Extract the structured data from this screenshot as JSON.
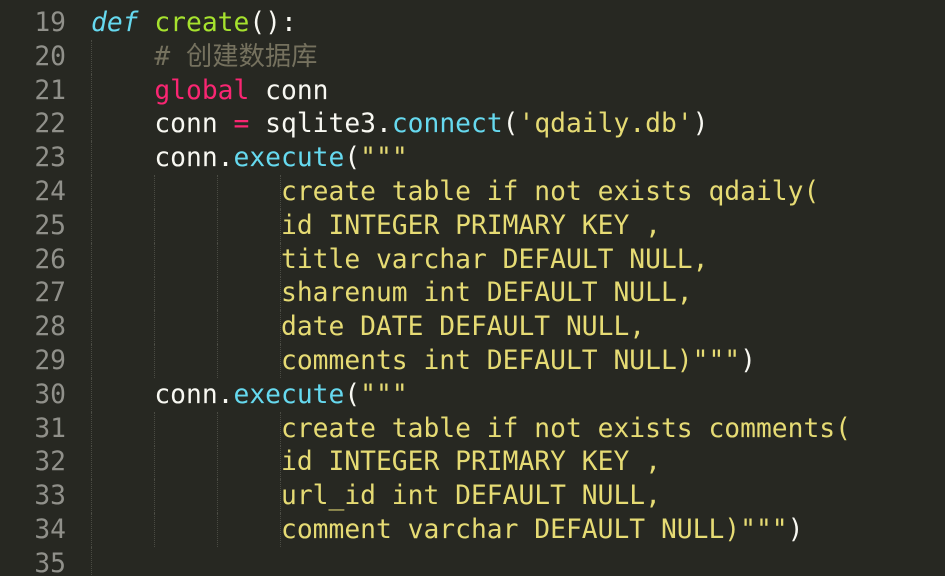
{
  "editor": {
    "theme_colors": {
      "background": "#272822",
      "line_number": "#90908a",
      "keyword": "#f92672",
      "def_keyword": "#66d9ef",
      "function": "#a6e22e",
      "string": "#e6db74",
      "comment": "#75715e",
      "text": "#f8f8f2"
    },
    "lines": [
      {
        "num": "19",
        "tokens": [
          {
            "t": "def",
            "c": "tok-kw-def"
          },
          {
            "t": " ",
            "c": "tok-plain"
          },
          {
            "t": "create",
            "c": "tok-fn"
          },
          {
            "t": "():",
            "c": "tok-plain"
          }
        ]
      },
      {
        "num": "20",
        "tokens": [
          {
            "t": "    # 创建数据库",
            "c": "tok-comment"
          }
        ]
      },
      {
        "num": "21",
        "tokens": [
          {
            "t": "    ",
            "c": "tok-plain"
          },
          {
            "t": "global",
            "c": "tok-kw"
          },
          {
            "t": " conn",
            "c": "tok-plain"
          }
        ]
      },
      {
        "num": "22",
        "tokens": [
          {
            "t": "    conn ",
            "c": "tok-plain"
          },
          {
            "t": "=",
            "c": "tok-op"
          },
          {
            "t": " sqlite3.",
            "c": "tok-plain"
          },
          {
            "t": "connect",
            "c": "tok-method"
          },
          {
            "t": "(",
            "c": "tok-plain"
          },
          {
            "t": "'qdaily.db'",
            "c": "tok-str"
          },
          {
            "t": ")",
            "c": "tok-plain"
          }
        ]
      },
      {
        "num": "23",
        "tokens": [
          {
            "t": "    conn.",
            "c": "tok-plain"
          },
          {
            "t": "execute",
            "c": "tok-method"
          },
          {
            "t": "(",
            "c": "tok-plain"
          },
          {
            "t": "\"\"\"",
            "c": "tok-str"
          }
        ]
      },
      {
        "num": "24",
        "tokens": [
          {
            "t": "            create table if not exists qdaily(",
            "c": "tok-str"
          }
        ]
      },
      {
        "num": "25",
        "tokens": [
          {
            "t": "            id INTEGER PRIMARY KEY ,",
            "c": "tok-str"
          }
        ]
      },
      {
        "num": "26",
        "tokens": [
          {
            "t": "            title varchar DEFAULT NULL,",
            "c": "tok-str"
          }
        ]
      },
      {
        "num": "27",
        "tokens": [
          {
            "t": "            sharenum int DEFAULT NULL,",
            "c": "tok-str"
          }
        ]
      },
      {
        "num": "28",
        "tokens": [
          {
            "t": "            date DATE DEFAULT NULL,",
            "c": "tok-str"
          }
        ]
      },
      {
        "num": "29",
        "tokens": [
          {
            "t": "            comments int DEFAULT NULL)\"\"\"",
            "c": "tok-str"
          },
          {
            "t": ")",
            "c": "tok-plain"
          }
        ]
      },
      {
        "num": "30",
        "tokens": [
          {
            "t": "    conn.",
            "c": "tok-plain"
          },
          {
            "t": "execute",
            "c": "tok-method"
          },
          {
            "t": "(",
            "c": "tok-plain"
          },
          {
            "t": "\"\"\"",
            "c": "tok-str"
          }
        ]
      },
      {
        "num": "31",
        "tokens": [
          {
            "t": "            create table if not exists comments(",
            "c": "tok-str"
          }
        ]
      },
      {
        "num": "32",
        "tokens": [
          {
            "t": "            id INTEGER PRIMARY KEY ,",
            "c": "tok-str"
          }
        ]
      },
      {
        "num": "33",
        "tokens": [
          {
            "t": "            url_id int DEFAULT NULL,",
            "c": "tok-str"
          }
        ]
      },
      {
        "num": "34",
        "tokens": [
          {
            "t": "            comment varchar DEFAULT NULL)\"\"\"",
            "c": "tok-str"
          },
          {
            "t": ")",
            "c": "tok-plain"
          }
        ]
      },
      {
        "num": "35",
        "tokens": []
      }
    ]
  }
}
